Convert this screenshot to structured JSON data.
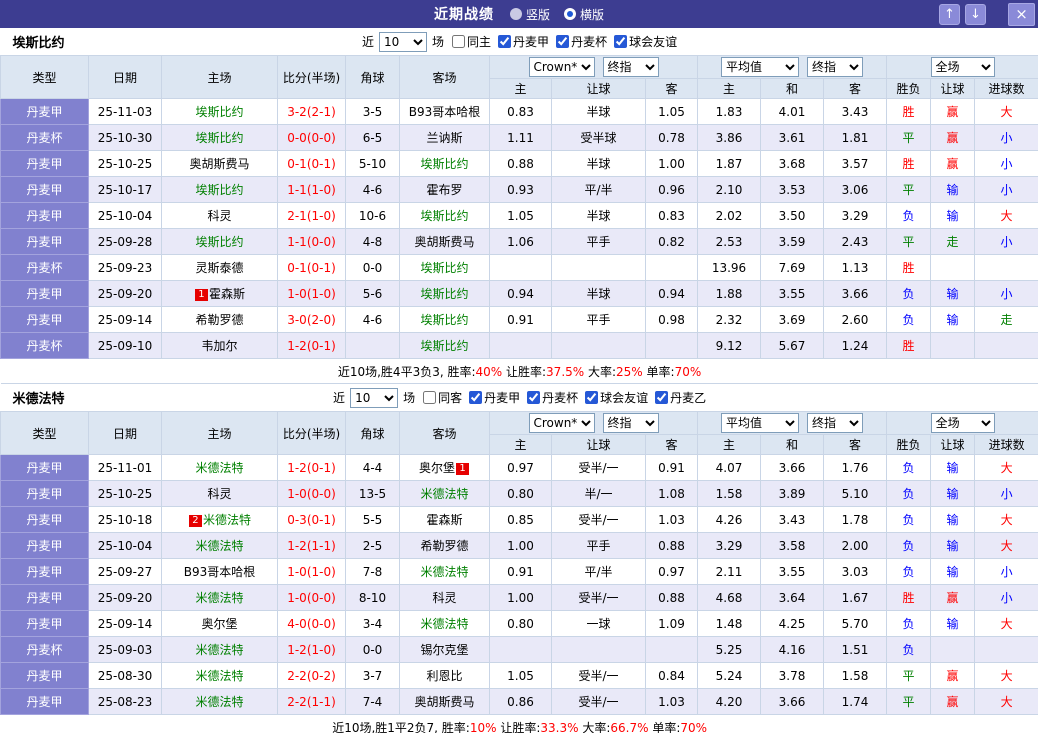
{
  "titlebar": {
    "title": "近期战绩",
    "layout_options": [
      {
        "label": "竖版",
        "selected": false
      },
      {
        "label": "横版",
        "selected": true
      }
    ],
    "up_icon": "↑",
    "down_icon": "↓",
    "close_icon": "×"
  },
  "filter_labels": {
    "near": "近",
    "unit": "场"
  },
  "table_header": {
    "type": "类型",
    "date": "日期",
    "home": "主场",
    "score": "比分(半场)",
    "corner": "角球",
    "away": "客场",
    "asian_selects": [
      "Crown*",
      "终指"
    ],
    "asian_cols": [
      "主",
      "让球",
      "客"
    ],
    "euro_selects": [
      "平均值",
      "终指"
    ],
    "euro_cols": [
      "主",
      "和",
      "客"
    ],
    "scope_select": "全场",
    "result_cols": [
      "胜负",
      "让球",
      "进球数"
    ]
  },
  "result_colors": {
    "胜": "#ff0000",
    "赢": "#ff0000",
    "大": "#ff0000",
    "平": "#008000",
    "走": "#008000",
    "负": "#0000ff",
    "输": "#0000ff",
    "小": "#0000ff"
  },
  "palette": {
    "titlebar_bg": "#3d3d91",
    "titlebar_button_bg": "#8a8ad8",
    "header_bg": "#dce6f2",
    "type_column_bg": "#8181cf",
    "alt_row_bg": "#e9e9f8",
    "focus_team_green": "#008000",
    "score_red": "#ff0000",
    "badge_red": "#e60000"
  },
  "sections": [
    {
      "team": "埃斯比约",
      "filter": {
        "count": "10",
        "checkboxes": [
          {
            "label": "同主",
            "checked": false
          },
          {
            "label": "丹麦甲",
            "checked": true
          },
          {
            "label": "丹麦杯",
            "checked": true
          },
          {
            "label": "球会友谊",
            "checked": true
          }
        ]
      },
      "rows": [
        {
          "type": "丹麦甲",
          "date": "25-11-03",
          "home": "埃斯比约",
          "home_focus": true,
          "score": "3-2(2-1)",
          "corner": "3-5",
          "away": "B93哥本哈根",
          "away_focus": false,
          "a_home": "0.83",
          "a_line": "半球",
          "a_away": "1.05",
          "e_home": "1.83",
          "e_draw": "4.01",
          "e_away": "3.43",
          "result": "胜",
          "cover": "赢",
          "goals": "大"
        },
        {
          "type": "丹麦杯",
          "date": "25-10-30",
          "home": "埃斯比约",
          "home_focus": true,
          "score": "0-0(0-0)",
          "corner": "6-5",
          "away": "兰讷斯",
          "away_focus": false,
          "a_home": "1.11",
          "a_line": "受半球",
          "a_away": "0.78",
          "e_home": "3.86",
          "e_draw": "3.61",
          "e_away": "1.81",
          "result": "平",
          "cover": "赢",
          "goals": "小"
        },
        {
          "type": "丹麦甲",
          "date": "25-10-25",
          "home": "奥胡斯费马",
          "home_focus": false,
          "score": "0-1(0-1)",
          "corner": "5-10",
          "away": "埃斯比约",
          "away_focus": true,
          "a_home": "0.88",
          "a_line": "半球",
          "a_away": "1.00",
          "e_home": "1.87",
          "e_draw": "3.68",
          "e_away": "3.57",
          "result": "胜",
          "cover": "赢",
          "goals": "小"
        },
        {
          "type": "丹麦甲",
          "date": "25-10-17",
          "home": "埃斯比约",
          "home_focus": true,
          "score": "1-1(1-0)",
          "corner": "4-6",
          "away": "霍布罗",
          "away_focus": false,
          "a_home": "0.93",
          "a_line": "平/半",
          "a_away": "0.96",
          "e_home": "2.10",
          "e_draw": "3.53",
          "e_away": "3.06",
          "result": "平",
          "cover": "输",
          "goals": "小"
        },
        {
          "type": "丹麦甲",
          "date": "25-10-04",
          "home": "科灵",
          "home_focus": false,
          "score": "2-1(1-0)",
          "corner": "10-6",
          "away": "埃斯比约",
          "away_focus": true,
          "a_home": "1.05",
          "a_line": "半球",
          "a_away": "0.83",
          "e_home": "2.02",
          "e_draw": "3.50",
          "e_away": "3.29",
          "result": "负",
          "cover": "输",
          "goals": "大"
        },
        {
          "type": "丹麦甲",
          "date": "25-09-28",
          "home": "埃斯比约",
          "home_focus": true,
          "score": "1-1(0-0)",
          "corner": "4-8",
          "away": "奥胡斯费马",
          "away_focus": false,
          "a_home": "1.06",
          "a_line": "平手",
          "a_away": "0.82",
          "e_home": "2.53",
          "e_draw": "3.59",
          "e_away": "2.43",
          "result": "平",
          "cover": "走",
          "goals": "小"
        },
        {
          "type": "丹麦杯",
          "date": "25-09-23",
          "home": "灵斯泰德",
          "home_focus": false,
          "score": "0-1(0-1)",
          "corner": "0-0",
          "away": "埃斯比约",
          "away_focus": true,
          "a_home": "",
          "a_line": "",
          "a_away": "",
          "e_home": "13.96",
          "e_draw": "7.69",
          "e_away": "1.13",
          "result": "胜",
          "cover": "",
          "goals": ""
        },
        {
          "type": "丹麦甲",
          "date": "25-09-20",
          "home": "霍森斯",
          "home_focus": false,
          "home_badge": "1",
          "home_badge_pos": "before",
          "score": "1-0(1-0)",
          "corner": "5-6",
          "away": "埃斯比约",
          "away_focus": true,
          "a_home": "0.94",
          "a_line": "半球",
          "a_away": "0.94",
          "e_home": "1.88",
          "e_draw": "3.55",
          "e_away": "3.66",
          "result": "负",
          "cover": "输",
          "goals": "小"
        },
        {
          "type": "丹麦甲",
          "date": "25-09-14",
          "home": "希勒罗德",
          "home_focus": false,
          "score": "3-0(2-0)",
          "corner": "4-6",
          "away": "埃斯比约",
          "away_focus": true,
          "a_home": "0.91",
          "a_line": "平手",
          "a_away": "0.98",
          "e_home": "2.32",
          "e_draw": "3.69",
          "e_away": "2.60",
          "result": "负",
          "cover": "输",
          "goals": "走"
        },
        {
          "type": "丹麦杯",
          "date": "25-09-10",
          "home": "韦加尔",
          "home_focus": false,
          "score": "1-2(0-1)",
          "corner": "",
          "away": "埃斯比约",
          "away_focus": true,
          "a_home": "",
          "a_line": "",
          "a_away": "",
          "e_home": "9.12",
          "e_draw": "5.67",
          "e_away": "1.24",
          "result": "胜",
          "cover": "",
          "goals": ""
        }
      ],
      "summary": [
        {
          "text": "近10场,胜4平3负3, 胜率:",
          "red": false
        },
        {
          "text": "40%",
          "red": true
        },
        {
          "text": " 让胜率:",
          "red": false
        },
        {
          "text": "37.5%",
          "red": true
        },
        {
          "text": " 大率:",
          "red": false
        },
        {
          "text": "25%",
          "red": true
        },
        {
          "text": " 单率:",
          "red": false
        },
        {
          "text": "70%",
          "red": true
        }
      ]
    },
    {
      "team": "米德法特",
      "filter": {
        "count": "10",
        "checkboxes": [
          {
            "label": "同客",
            "checked": false
          },
          {
            "label": "丹麦甲",
            "checked": true
          },
          {
            "label": "丹麦杯",
            "checked": true
          },
          {
            "label": "球会友谊",
            "checked": true
          },
          {
            "label": "丹麦乙",
            "checked": true
          }
        ]
      },
      "rows": [
        {
          "type": "丹麦甲",
          "date": "25-11-01",
          "home": "米德法特",
          "home_focus": true,
          "score": "1-2(0-1)",
          "corner": "4-4",
          "away": "奥尔堡",
          "away_focus": false,
          "away_badge": "1",
          "away_badge_pos": "after",
          "a_home": "0.97",
          "a_line": "受半/一",
          "a_away": "0.91",
          "e_home": "4.07",
          "e_draw": "3.66",
          "e_away": "1.76",
          "result": "负",
          "cover": "输",
          "goals": "大"
        },
        {
          "type": "丹麦甲",
          "date": "25-10-25",
          "home": "科灵",
          "home_focus": false,
          "score": "1-0(0-0)",
          "corner": "13-5",
          "away": "米德法特",
          "away_focus": true,
          "a_home": "0.80",
          "a_line": "半/一",
          "a_away": "1.08",
          "e_home": "1.58",
          "e_draw": "3.89",
          "e_away": "5.10",
          "result": "负",
          "cover": "输",
          "goals": "小"
        },
        {
          "type": "丹麦甲",
          "date": "25-10-18",
          "home": "米德法特",
          "home_focus": true,
          "home_badge": "2",
          "home_badge_pos": "before",
          "score": "0-3(0-1)",
          "corner": "5-5",
          "away": "霍森斯",
          "away_focus": false,
          "a_home": "0.85",
          "a_line": "受半/一",
          "a_away": "1.03",
          "e_home": "4.26",
          "e_draw": "3.43",
          "e_away": "1.78",
          "result": "负",
          "cover": "输",
          "goals": "大"
        },
        {
          "type": "丹麦甲",
          "date": "25-10-04",
          "home": "米德法特",
          "home_focus": true,
          "score": "1-2(1-1)",
          "corner": "2-5",
          "away": "希勒罗德",
          "away_focus": false,
          "a_home": "1.00",
          "a_line": "平手",
          "a_away": "0.88",
          "e_home": "3.29",
          "e_draw": "3.58",
          "e_away": "2.00",
          "result": "负",
          "cover": "输",
          "goals": "大"
        },
        {
          "type": "丹麦甲",
          "date": "25-09-27",
          "home": "B93哥本哈根",
          "home_focus": false,
          "score": "1-0(1-0)",
          "corner": "7-8",
          "away": "米德法特",
          "away_focus": true,
          "a_home": "0.91",
          "a_line": "平/半",
          "a_away": "0.97",
          "e_home": "2.11",
          "e_draw": "3.55",
          "e_away": "3.03",
          "result": "负",
          "cover": "输",
          "goals": "小"
        },
        {
          "type": "丹麦甲",
          "date": "25-09-20",
          "home": "米德法特",
          "home_focus": true,
          "score": "1-0(0-0)",
          "corner": "8-10",
          "away": "科灵",
          "away_focus": false,
          "a_home": "1.00",
          "a_line": "受半/一",
          "a_away": "0.88",
          "e_home": "4.68",
          "e_draw": "3.64",
          "e_away": "1.67",
          "result": "胜",
          "cover": "赢",
          "goals": "小"
        },
        {
          "type": "丹麦甲",
          "date": "25-09-14",
          "home": "奥尔堡",
          "home_focus": false,
          "score": "4-0(0-0)",
          "corner": "3-4",
          "away": "米德法特",
          "away_focus": true,
          "a_home": "0.80",
          "a_line": "一球",
          "a_away": "1.09",
          "e_home": "1.48",
          "e_draw": "4.25",
          "e_away": "5.70",
          "result": "负",
          "cover": "输",
          "goals": "大"
        },
        {
          "type": "丹麦杯",
          "date": "25-09-03",
          "home": "米德法特",
          "home_focus": true,
          "score": "1-2(1-0)",
          "corner": "0-0",
          "away": "锡尔克堡",
          "away_focus": false,
          "a_home": "",
          "a_line": "",
          "a_away": "",
          "e_home": "5.25",
          "e_draw": "4.16",
          "e_away": "1.51",
          "result": "负",
          "cover": "",
          "goals": ""
        },
        {
          "type": "丹麦甲",
          "date": "25-08-30",
          "home": "米德法特",
          "home_focus": true,
          "score": "2-2(0-2)",
          "corner": "3-7",
          "away": "利恩比",
          "away_focus": false,
          "a_home": "1.05",
          "a_line": "受半/一",
          "a_away": "0.84",
          "e_home": "5.24",
          "e_draw": "3.78",
          "e_away": "1.58",
          "result": "平",
          "cover": "赢",
          "goals": "大"
        },
        {
          "type": "丹麦甲",
          "date": "25-08-23",
          "home": "米德法特",
          "home_focus": true,
          "score": "2-2(1-1)",
          "corner": "7-4",
          "away": "奥胡斯费马",
          "away_focus": false,
          "a_home": "0.86",
          "a_line": "受半/一",
          "a_away": "1.03",
          "e_home": "4.20",
          "e_draw": "3.66",
          "e_away": "1.74",
          "result": "平",
          "cover": "赢",
          "goals": "大"
        }
      ],
      "summary": [
        {
          "text": "近10场,胜1平2负7, 胜率:",
          "red": false
        },
        {
          "text": "10%",
          "red": true
        },
        {
          "text": " 让胜率:",
          "red": false
        },
        {
          "text": "33.3%",
          "red": true
        },
        {
          "text": " 大率:",
          "red": false
        },
        {
          "text": "66.7%",
          "red": true
        },
        {
          "text": " 单率:",
          "red": false
        },
        {
          "text": "70%",
          "red": true
        }
      ]
    }
  ]
}
